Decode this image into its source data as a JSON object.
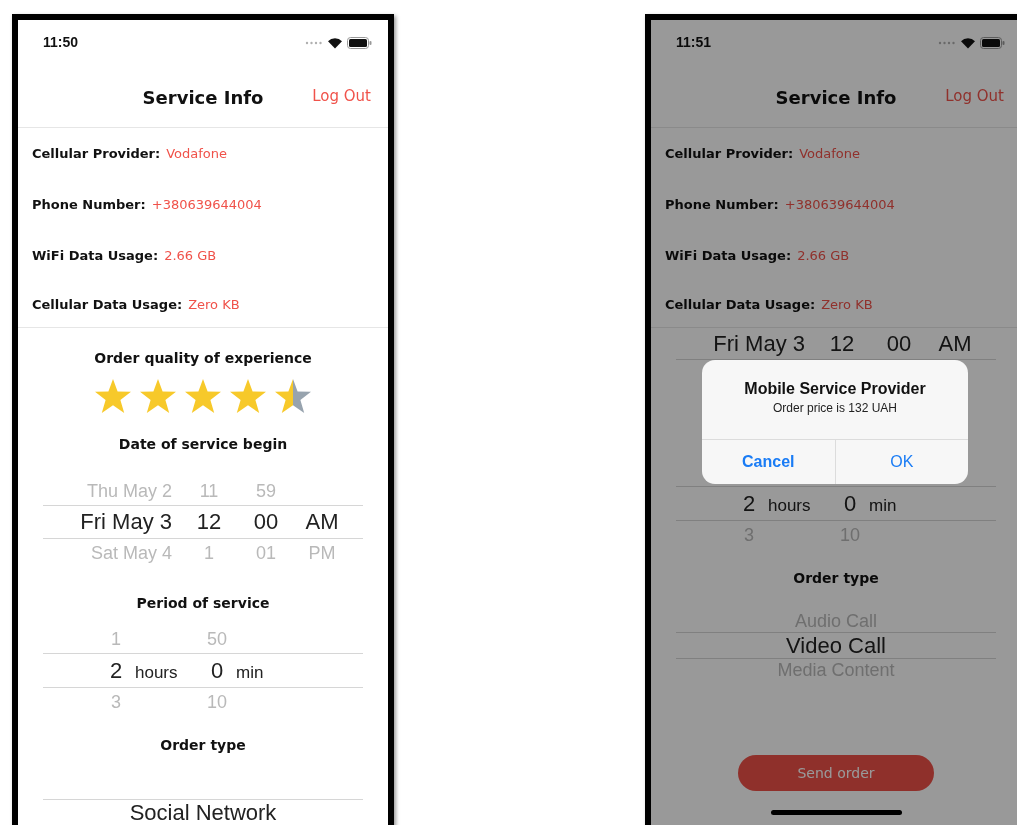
{
  "screens": [
    {
      "status_bar": {
        "time": "11:50"
      },
      "nav": {
        "title": "Service Info",
        "action": "Log Out"
      },
      "info": [
        {
          "label": "Cellular Provider:",
          "value": "Vodafone"
        },
        {
          "label": "Phone Number:",
          "value": "+380639644004"
        },
        {
          "label": "WiFi Data Usage:",
          "value": "2.66 GB"
        },
        {
          "label": "Cellular Data Usage:",
          "value": "Zero KB"
        }
      ],
      "sections": [
        {
          "kind": "heading",
          "text": "Order quality of experience"
        },
        {
          "kind": "rating",
          "stars": 4.5
        },
        {
          "kind": "heading",
          "text": "Date of service begin"
        },
        {
          "kind": "date_picker",
          "rows": [
            {
              "cells": [
                {
                  "value": "Thu May 2"
                },
                {
                  "value": "11"
                },
                {
                  "value": "59"
                }
              ],
              "selected": false
            },
            {
              "cells": [
                {
                  "value": "Fri May 3"
                },
                {
                  "value": "12"
                },
                {
                  "value": "00"
                },
                {
                  "value": "AM"
                }
              ],
              "selected": true
            },
            {
              "cells": [
                {
                  "value": "Sat May 4"
                },
                {
                  "value": "1"
                },
                {
                  "value": "01"
                },
                {
                  "value": "PM"
                }
              ],
              "selected": false
            }
          ]
        },
        {
          "kind": "heading",
          "text": "Period of service"
        },
        {
          "kind": "duration_picker",
          "rows": [
            {
              "cells": [
                {
                  "value": "1"
                },
                {
                  "value": "50"
                }
              ],
              "selected": false
            },
            {
              "cells": [
                {
                  "value": "2",
                  "unit": "hours"
                },
                {
                  "value": "0",
                  "unit": "min"
                }
              ],
              "selected": true
            },
            {
              "cells": [
                {
                  "value": "3"
                },
                {
                  "value": "10"
                }
              ],
              "selected": false
            }
          ]
        },
        {
          "kind": "heading",
          "text": "Order type"
        },
        {
          "kind": "list_picker",
          "rows": [
            {
              "cells": [
                {
                  "value": "Social Network"
                }
              ],
              "selected": true
            }
          ]
        }
      ],
      "dimmed": false
    },
    {
      "status_bar": {
        "time": "11:51"
      },
      "nav": {
        "title": "Service Info",
        "action": "Log Out"
      },
      "info": [
        {
          "label": "Cellular Provider:",
          "value": "Vodafone"
        },
        {
          "label": "Phone Number:",
          "value": "+380639644004"
        },
        {
          "label": "WiFi Data Usage:",
          "value": "2.66 GB"
        },
        {
          "label": "Cellular Data Usage:",
          "value": "Zero KB"
        }
      ],
      "sections": [
        {
          "kind": "date_picker",
          "rows": [
            {
              "cells": [
                {
                  "value": "Fri May 3"
                },
                {
                  "value": "12"
                },
                {
                  "value": "00"
                },
                {
                  "value": "AM"
                }
              ],
              "selected": true
            }
          ]
        },
        {
          "kind": "duration_picker",
          "rows": [
            {
              "cells": [
                {
                  "value": "2",
                  "unit": "hours"
                },
                {
                  "value": "0",
                  "unit": "min"
                }
              ],
              "selected": true
            },
            {
              "cells": [
                {
                  "value": "3"
                },
                {
                  "value": "10"
                }
              ],
              "selected": false
            }
          ]
        },
        {
          "kind": "heading",
          "text": "Order type"
        },
        {
          "kind": "list_picker",
          "rows": [
            {
              "cells": [
                {
                  "value": "Audio Call"
                }
              ],
              "selected": false
            },
            {
              "cells": [
                {
                  "value": "Video Call"
                }
              ],
              "selected": true
            },
            {
              "cells": [
                {
                  "value": "Media Content"
                }
              ],
              "selected": false
            }
          ]
        },
        {
          "kind": "button",
          "text": "Send order"
        }
      ],
      "dimmed": true,
      "home_indicator": true,
      "alert": {
        "title": "Mobile Service Provider",
        "message": "Order price is 132 UAH",
        "buttons": [
          {
            "label": "Cancel",
            "kind": "cancel"
          },
          {
            "label": "OK",
            "kind": "default"
          }
        ]
      }
    }
  ]
}
